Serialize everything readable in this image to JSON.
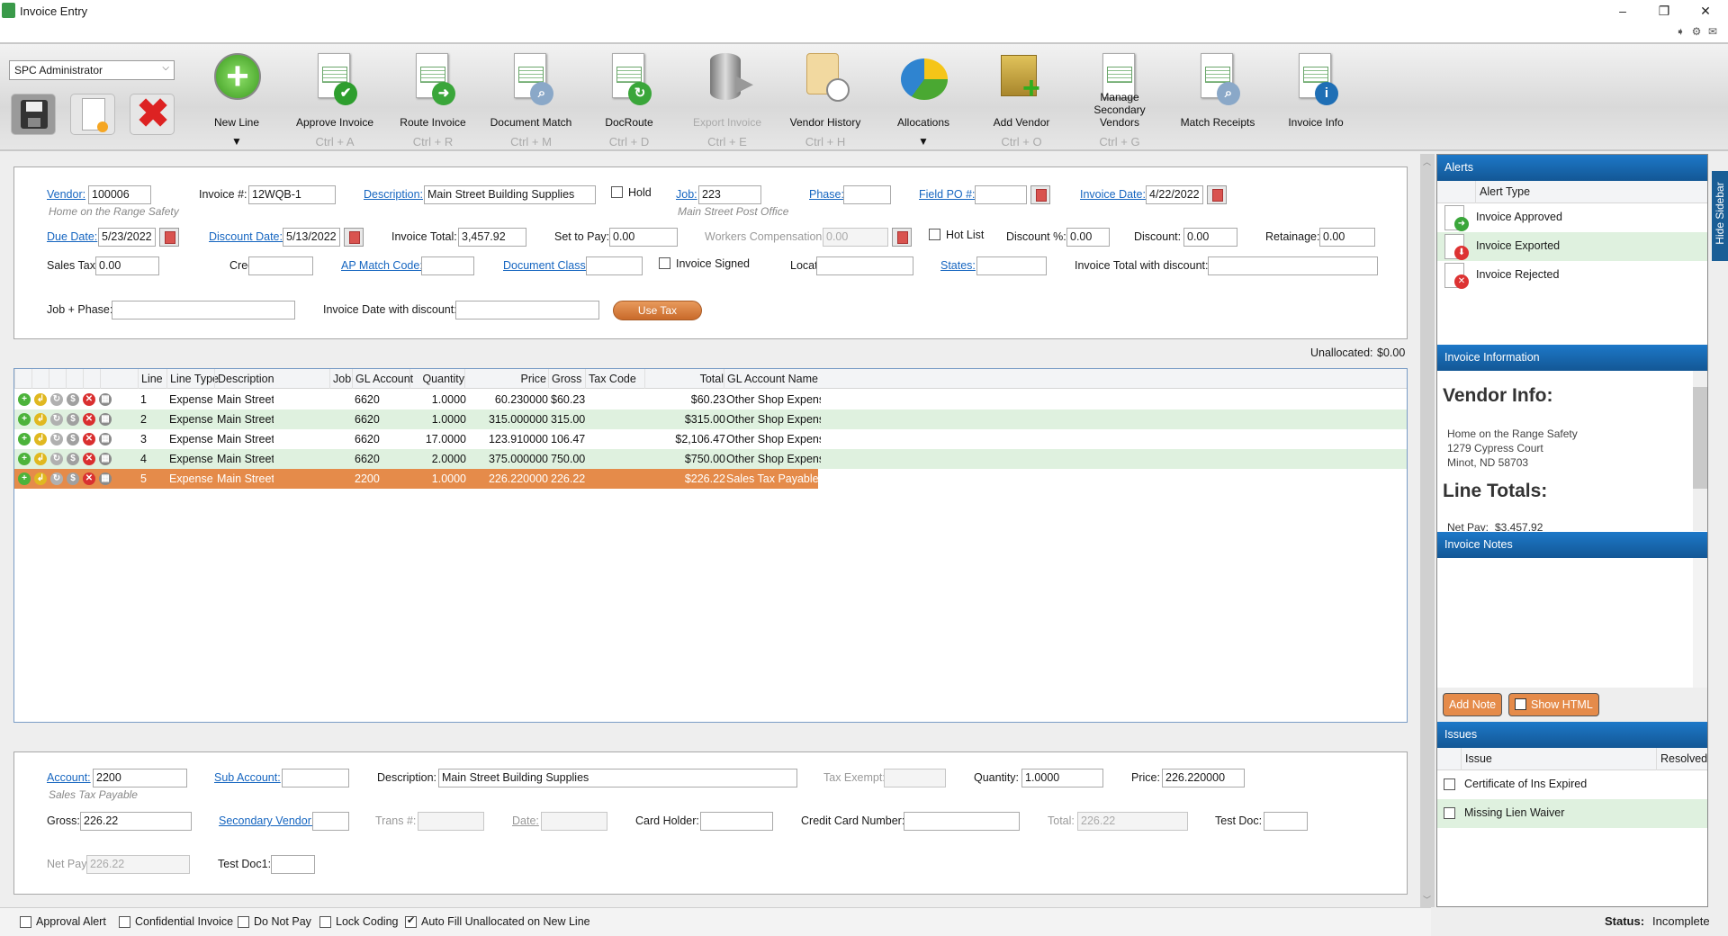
{
  "window": {
    "title": "Invoice Entry",
    "minimize": "–",
    "restore": "❐",
    "close": "✕"
  },
  "toolbar": {
    "user_select": "SPC Administrator",
    "quick": [
      {
        "icon": "save-icon"
      },
      {
        "icon": "new-invoice-icon"
      },
      {
        "icon": "delete-icon"
      }
    ],
    "buttons": [
      {
        "label": "New Line",
        "shortcut": "",
        "dropdown": "▼",
        "icon": "green-plus-icon"
      },
      {
        "label": "Approve Invoice",
        "shortcut": "Ctrl + A",
        "icon": "approve-invoice-icon"
      },
      {
        "label": "Route Invoice",
        "shortcut": "Ctrl + R",
        "icon": "route-invoice-icon"
      },
      {
        "label": "Document Match",
        "shortcut": "Ctrl + M",
        "icon": "document-match-icon"
      },
      {
        "label": "DocRoute",
        "shortcut": "Ctrl + D",
        "icon": "docroute-icon"
      },
      {
        "label": "Export Invoice",
        "shortcut": "Ctrl + E",
        "icon": "database-export-icon",
        "disabled": true
      },
      {
        "label": "Vendor History",
        "shortcut": "Ctrl + H",
        "icon": "scroll-clock-icon"
      },
      {
        "label": "Allocations",
        "shortcut": "",
        "dropdown": "▼",
        "icon": "pie-chart-icon"
      },
      {
        "label": "Add Vendor",
        "shortcut": "Ctrl + O",
        "icon": "box-plus-icon"
      },
      {
        "label": "Manage Secondary Vendors",
        "shortcut": "Ctrl + G",
        "icon": "sales-quotation-icon"
      },
      {
        "label": "Match Receipts",
        "shortcut": "",
        "icon": "receipt-search-icon"
      },
      {
        "label": "Invoice Info",
        "shortcut": "",
        "icon": "invoice-info-icon"
      }
    ]
  },
  "header": {
    "vendor": {
      "label": "Vendor:",
      "value": "100006",
      "subtext": "Home on the Range Safety"
    },
    "invoice_no": {
      "label": "Invoice #:",
      "value": "12WQB-1"
    },
    "description": {
      "label": "Description:",
      "value": "Main Street Building Supplies"
    },
    "hold": {
      "label": "Hold",
      "checked": false
    },
    "job": {
      "label": "Job:",
      "value": "223",
      "subtext": "Main Street Post Office"
    },
    "phase": {
      "label": "Phase:",
      "value": ""
    },
    "field_po": {
      "label": "Field PO #:",
      "value": ""
    },
    "invoice_date": {
      "label": "Invoice Date:",
      "value": "4/22/2022"
    },
    "due_date": {
      "label": "Due Date:",
      "value": "5/23/2022"
    },
    "discount_date": {
      "label": "Discount Date:",
      "value": "5/13/2022"
    },
    "invoice_total": {
      "label": "Invoice Total:",
      "value": "3,457.92"
    },
    "set_to_pay": {
      "label": "Set to Pay:",
      "value": "0.00"
    },
    "workers_comp": {
      "label": "Workers Compensation:",
      "value": "0.00"
    },
    "hot_list": {
      "label": "Hot List",
      "checked": false
    },
    "discount_pct": {
      "label": "Discount %:",
      "value": "0.00"
    },
    "discount": {
      "label": "Discount:",
      "value": "0.00"
    },
    "retainage": {
      "label": "Retainage:",
      "value": "0.00"
    },
    "sales_tax": {
      "label": "Sales Tax:",
      "value": "0.00"
    },
    "credit_card": {
      "label": "Credit Card:",
      "value": ""
    },
    "ap_match": {
      "label": "AP Match Code:",
      "value": ""
    },
    "doc_class": {
      "label": "Document Class:",
      "value": ""
    },
    "invoice_signed": {
      "label": "Invoice Signed",
      "checked": false
    },
    "location": {
      "label": "Location:",
      "value": ""
    },
    "states": {
      "label": "States:",
      "value": ""
    },
    "total_with_discount": {
      "label": "Invoice Total with discount:",
      "value": ""
    },
    "job_phase": {
      "label": "Job + Phase:",
      "value": ""
    },
    "date_with_discount": {
      "label": "Invoice Date with discount:",
      "value": ""
    },
    "use_tax": "Use Tax"
  },
  "unallocated": {
    "label": "Unallocated:",
    "value": "$0.00"
  },
  "grid": {
    "columns": [
      "Line",
      "Line Type",
      "Description",
      "Job",
      "GL Account",
      "Quantity",
      "Price",
      "Gross",
      "Tax Code",
      "Total",
      "GL Account Name"
    ],
    "rows": [
      {
        "line": "1",
        "type": "Expense",
        "description": "Main Street",
        "job": "",
        "gl": "6620",
        "qty": "1.0000",
        "price": "60.230000",
        "gross": "$60.23",
        "tax": "",
        "total": "$60.23",
        "gl_name": "Other Shop Expens"
      },
      {
        "line": "2",
        "type": "Expense",
        "description": "Main Street",
        "job": "",
        "gl": "6620",
        "qty": "1.0000",
        "price": "315.000000",
        "gross": "315.00",
        "tax": "",
        "total": "$315.00",
        "gl_name": "Other Shop Expens"
      },
      {
        "line": "3",
        "type": "Expense",
        "description": "Main Street",
        "job": "",
        "gl": "6620",
        "qty": "17.0000",
        "price": "123.910000",
        "gross": "106.47",
        "tax": "",
        "total": "$2,106.47",
        "gl_name": "Other Shop Expens"
      },
      {
        "line": "4",
        "type": "Expense",
        "description": "Main Street",
        "job": "",
        "gl": "6620",
        "qty": "2.0000",
        "price": "375.000000",
        "gross": "750.00",
        "tax": "",
        "total": "$750.00",
        "gl_name": "Other Shop Expens"
      },
      {
        "line": "5",
        "type": "Expense",
        "description": "Main Street",
        "job": "",
        "gl": "2200",
        "qty": "1.0000",
        "price": "226.220000",
        "gross": "226.22",
        "tax": "",
        "total": "$226.22",
        "gl_name": "Sales Tax Payable",
        "selected": true
      }
    ],
    "row_alt_color": "#dff1df",
    "selected_color": "#e58b4a"
  },
  "detail": {
    "account": {
      "label": "Account:",
      "value": "2200",
      "subtext": "Sales Tax Payable"
    },
    "sub_account": {
      "label": "Sub Account:",
      "value": ""
    },
    "description": {
      "label": "Description:",
      "value": "Main Street Building Supplies"
    },
    "tax_exempt": {
      "label": "Tax Exempt:",
      "value": ""
    },
    "quantity": {
      "label": "Quantity:",
      "value": "1.0000"
    },
    "price": {
      "label": "Price:",
      "value": "226.220000"
    },
    "gross": {
      "label": "Gross:",
      "value": "226.22"
    },
    "secondary_vendor": {
      "label": "Secondary Vendor:",
      "value": ""
    },
    "trans_no": {
      "label": "Trans #:",
      "value": ""
    },
    "date": {
      "label": "Date:",
      "value": ""
    },
    "card_holder": {
      "label": "Card Holder:",
      "value": ""
    },
    "cc_number": {
      "label": "Credit Card Number:",
      "value": ""
    },
    "total": {
      "label": "Total:",
      "value": "226.22"
    },
    "test_doc": {
      "label": "Test Doc:",
      "value": ""
    },
    "net_pay": {
      "label": "Net Pay:",
      "value": "226.22"
    },
    "test_doc1": {
      "label": "Test Doc1:",
      "value": ""
    }
  },
  "footer": {
    "checks": [
      {
        "label": "Approval Alert",
        "checked": false
      },
      {
        "label": "Confidential Invoice",
        "checked": false
      },
      {
        "label": "Do Not Pay",
        "checked": false
      },
      {
        "label": "Lock Coding",
        "checked": false
      },
      {
        "label": "Auto Fill Unallocated on New Line",
        "checked": true
      }
    ],
    "status_label": "Status:",
    "status_value": "Incomplete"
  },
  "sidebar": {
    "hide_label": "Hide Sidebar",
    "alerts": {
      "title": "Alerts",
      "column": "Alert Type",
      "items": [
        "Invoice Approved",
        "Invoice Exported",
        "Invoice Rejected"
      ]
    },
    "info": {
      "title": "Invoice Information",
      "vendor_heading": "Vendor Info:",
      "vendor_name": "Home on the Range Safety",
      "address1": "1279 Cypress Court",
      "address2": "Minot, ND 58703",
      "totals_heading": "Line Totals:",
      "net_pay_label": "Net Pay:",
      "net_pay_value": "$3,457.92"
    },
    "notes": {
      "title": "Invoice Notes",
      "add_note": "Add Note",
      "show_html": "Show HTML",
      "show_html_checked": true
    },
    "issues": {
      "title": "Issues",
      "col_issue": "Issue",
      "col_resolved": "Resolved",
      "items": [
        {
          "label": "Certificate of Ins Expired",
          "resolved": false
        },
        {
          "label": "Missing Lien Waiver",
          "resolved": false
        }
      ]
    }
  }
}
